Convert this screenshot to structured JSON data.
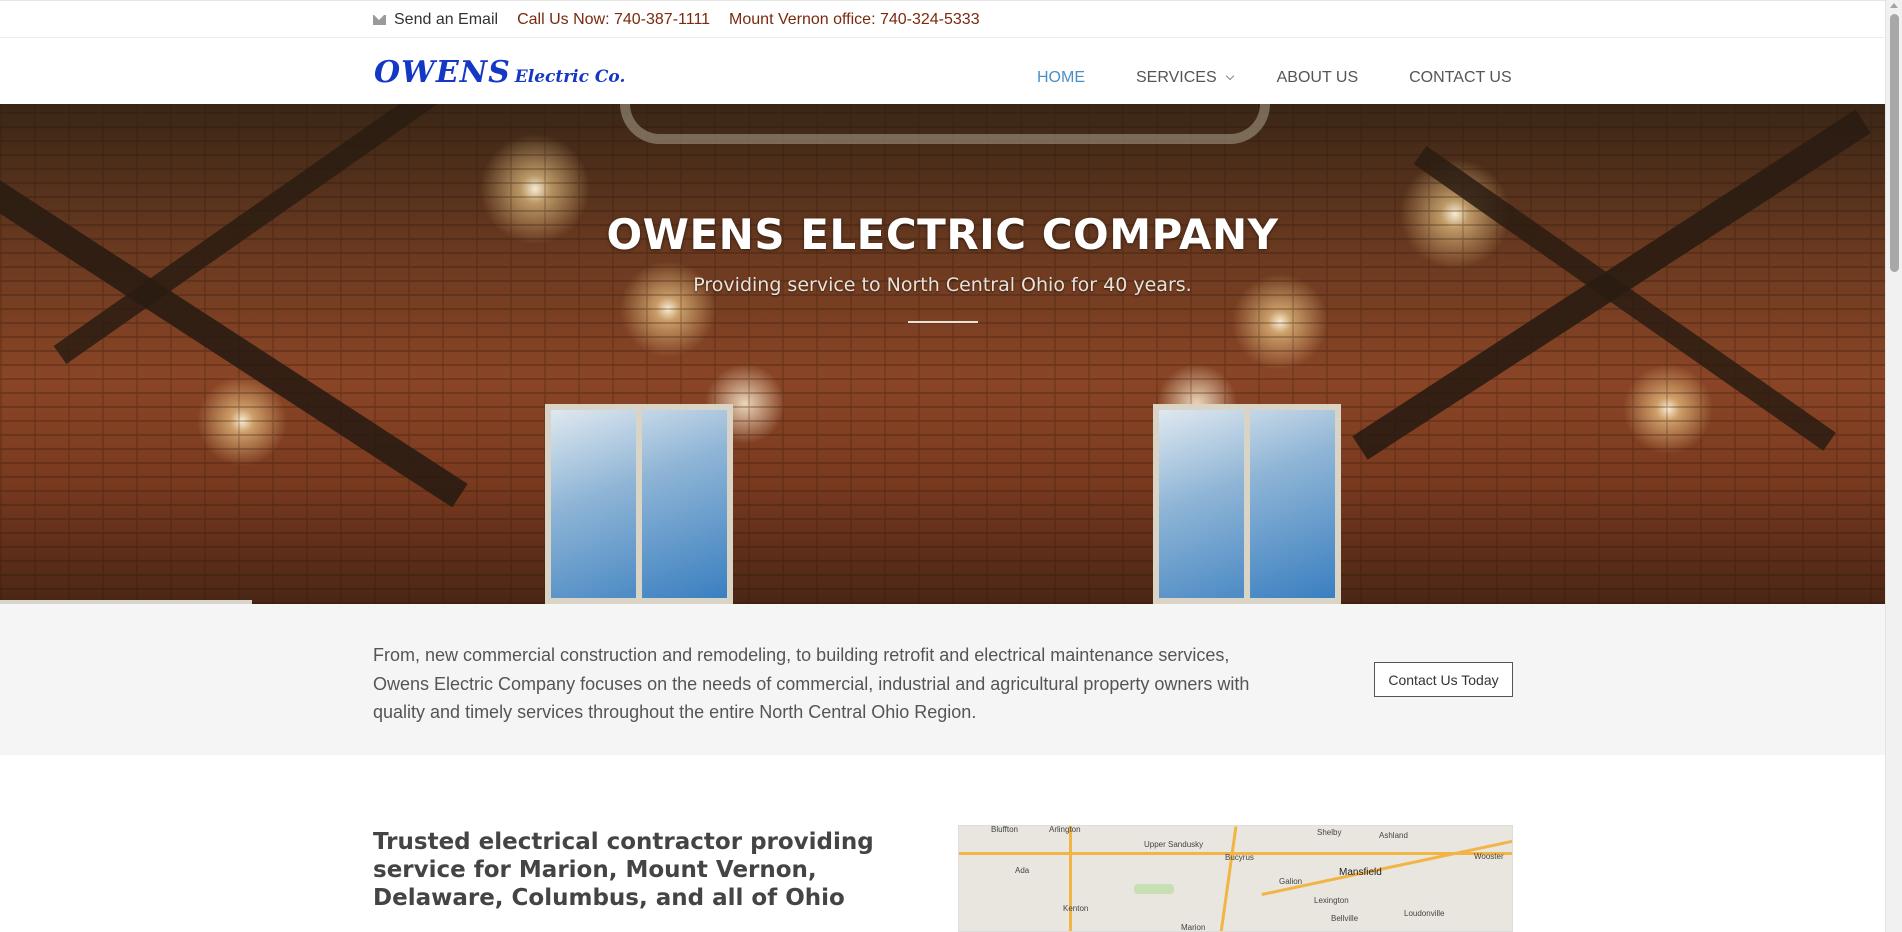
{
  "topbar": {
    "email_label": "Send an Email",
    "phone_label": "Call Us Now: 740-387-1111",
    "office_label": "Mount Vernon office: 740-324-5333"
  },
  "header": {
    "logo_main": "OWENS",
    "logo_sub": "Electric Co.",
    "nav": [
      {
        "label": "HOME",
        "active": true
      },
      {
        "label": "SERVICES",
        "has_dropdown": true
      },
      {
        "label": "ABOUT US"
      },
      {
        "label": "CONTACT US"
      }
    ]
  },
  "hero": {
    "title": "OWENS ELECTRIC COMPANY",
    "subtitle": "Providing service to North Central Ohio for 40 years."
  },
  "intro": {
    "text": "From, new commercial construction and remodeling, to building retrofit and electrical maintenance services, Owens Electric Company focuses on the needs of commercial, industrial and agricultural property owners with quality and timely services throughout the entire North Central Ohio Region.",
    "cta_label": "Contact Us Today"
  },
  "lower": {
    "title": "Trusted electrical contractor providing service for Marion, Mount Vernon, Delaware, Columbus, and all of Ohio"
  },
  "map": {
    "labels": [
      "Bluffton",
      "Arlington",
      "Upper Sandusky",
      "Shelby",
      "Ashland",
      "Ada",
      "Bucyrus",
      "Galion",
      "Mansfield",
      "Wooster",
      "Kenton",
      "Lexington",
      "Loudonville",
      "Bellville",
      "Marion"
    ]
  },
  "colors": {
    "accent_nav": "#4a90c8",
    "phone_text": "#7a2a0d",
    "logo": "#1437c6",
    "intro_bg": "#f5f5f5"
  },
  "icons": {
    "email": "envelope-icon",
    "dropdown": "chevron-down-icon"
  }
}
